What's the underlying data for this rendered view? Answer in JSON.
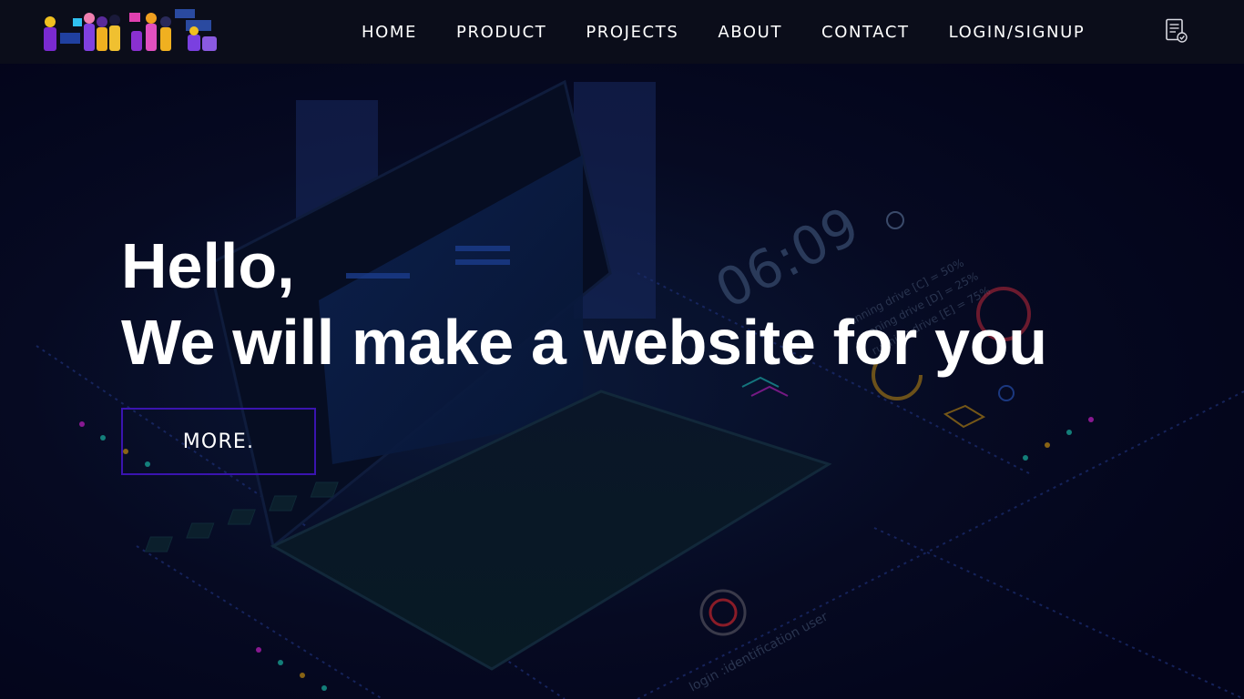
{
  "nav": {
    "items": [
      {
        "label": "HOME"
      },
      {
        "label": "PRODUCT"
      },
      {
        "label": "PROJECTS"
      },
      {
        "label": "ABOUT"
      },
      {
        "label": "CONTACT"
      },
      {
        "label": "LOGIN/SIGNUP"
      }
    ],
    "right_icon": "document-check-icon"
  },
  "hero": {
    "greeting": "Hello,",
    "headline": "We will make a website for you",
    "button_label": "MORE.",
    "background": {
      "clock_readout": "06:09",
      "power_caption": "login :identification user",
      "drive_lines": [
        "running drive [C] = 50%",
        "running drive [D] = 25%",
        "running drive [E] = 75%"
      ]
    }
  },
  "colors": {
    "background": "#05061a",
    "navbar": "#0c0e1a",
    "button_border": "#3a14b0",
    "text": "#ffffff"
  }
}
